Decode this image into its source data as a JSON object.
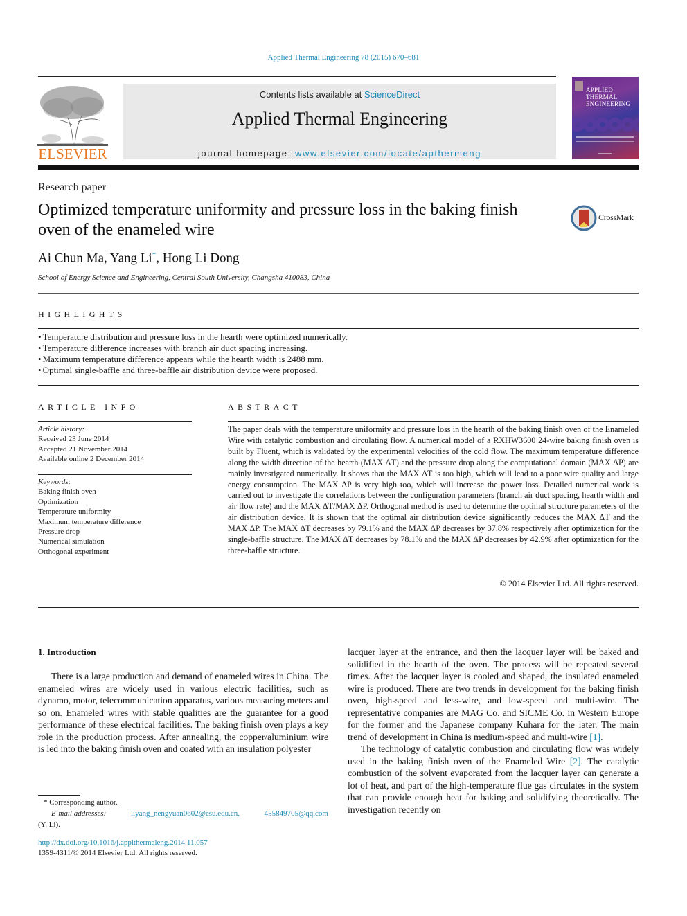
{
  "header": {
    "citation": "Applied Thermal Engineering 78 (2015) 670–681",
    "publisher_logo_text": "ELSEVIER",
    "contents_prefix": "Contents lists available at ",
    "contents_link": "ScienceDirect",
    "journal_title": "Applied Thermal Engineering",
    "homepage_prefix": "journal homepage: ",
    "homepage_link": "www.elsevier.com/locate/apthermeng",
    "cover_title_lines": [
      "APPLIED",
      "THERMAL",
      "ENGINEERING"
    ]
  },
  "article": {
    "type": "Research paper",
    "title": "Optimized temperature uniformity and pressure loss in the baking finish oven of the enameled wire",
    "crossmark_label": "CrossMark",
    "authors_part1": "Ai Chun Ma, Yang Li",
    "corresponding_marker": "*",
    "authors_part2": ", Hong Li Dong",
    "affiliation": "School of Energy Science and Engineering, Central South University, Changsha 410083, China"
  },
  "highlights": {
    "heading": "HIGHLIGHTS",
    "items": [
      "Temperature distribution and pressure loss in the hearth were optimized numerically.",
      "Temperature difference increases with branch air duct spacing increasing.",
      "Maximum temperature difference appears while the hearth width is 2488 mm.",
      "Optimal single-baffle and three-baffle air distribution device were proposed."
    ]
  },
  "article_info": {
    "heading": "ARTICLE INFO",
    "history_label": "Article history:",
    "history": [
      "Received 23 June 2014",
      "Accepted 21 November 2014",
      "Available online 2 December 2014"
    ],
    "keywords_label": "Keywords:",
    "keywords": [
      "Baking finish oven",
      "Optimization",
      "Temperature uniformity",
      "Maximum temperature difference",
      "Pressure drop",
      "Numerical simulation",
      "Orthogonal experiment"
    ]
  },
  "abstract": {
    "heading": "ABSTRACT",
    "text": "The paper deals with the temperature uniformity and pressure loss in the hearth of the baking finish oven of the Enameled Wire with catalytic combustion and circulating flow. A numerical model of a RXHW3600 24-wire baking finish oven is built by Fluent, which is validated by the experimental velocities of the cold flow. The maximum temperature difference along the width direction of the hearth (MAX ΔT) and the pressure drop along the computational domain (MAX ΔP) are mainly investigated numerically. It shows that the MAX ΔT is too high, which will lead to a poor wire quality and large energy consumption. The MAX ΔP is very high too, which will increase the power loss. Detailed numerical work is carried out to investigate the correlations between the configuration parameters (branch air duct spacing, hearth width and air flow rate) and the MAX ΔT/MAX ΔP. Orthogonal method is used to determine the optimal structure parameters of the air distribution device. It is shown that the optimal air distribution device significantly reduces the MAX ΔT and the MAX ΔP. The MAX ΔT decreases by 79.1% and the MAX ΔP decreases by 37.8% respectively after optimization for the single-baffle structure. The MAX ΔT decreases by 78.1% and the MAX ΔP decreases by 42.9% after optimization for the three-baffle structure.",
    "copyright": "© 2014 Elsevier Ltd. All rights reserved."
  },
  "body": {
    "intro_heading": "1.  Introduction",
    "col1_p1": "There is a large production and demand of enameled wires in China. The enameled wires are widely used in various electric facilities, such as dynamo, motor, telecommunication apparatus, various measuring meters and so on. Enameled wires with stable qualities are the guarantee for a good performance of these electrical facilities. The baking finish oven plays a key role in the production process. After annealing, the copper/aluminium wire is led into the baking finish oven and coated with an insulation polyester",
    "col2_p1": "lacquer layer at the entrance, and then the lacquer layer will be baked and solidified in the hearth of the oven. The process will be repeated several times. After the lacquer layer is cooled and shaped, the insulated enameled wire is produced. There are two trends in development for the baking finish oven, high-speed and less-wire, and low-speed and multi-wire. The representative companies are MAG Co. and SICME Co. in Western Europe for the former and the Japanese company Kuhara for the later. The main trend of development in China is medium-speed and multi-wire ",
    "col2_p1_ref": "[1]",
    "col2_p1_end": ".",
    "col2_p2": "The technology of catalytic combustion and circulating flow was widely used in the baking finish oven of the Enameled Wire ",
    "col2_p2_ref": "[2]",
    "col2_p2_rest": ". The catalytic combustion of the solvent evaporated from the lacquer layer can generate a lot of heat, and part of the high-temperature flue gas circulates in the system that can provide enough heat for baking and solidifying theoretically. The investigation recently on"
  },
  "footnote": {
    "corresponding": "* Corresponding author.",
    "email_label": "E-mail addresses:",
    "email1": "liyang_nengyuan0602@csu.edu.cn,",
    "email2": "455849705@qq.com",
    "email_owner": "(Y. Li).",
    "doi": "http://dx.doi.org/10.1016/j.applthermaleng.2014.11.057",
    "issn": "1359-4311/© 2014 Elsevier Ltd. All rights reserved."
  },
  "colors": {
    "link": "#1f8ab5",
    "elsevier_orange": "#e87722",
    "banner_bg": "#e9e9e9"
  }
}
